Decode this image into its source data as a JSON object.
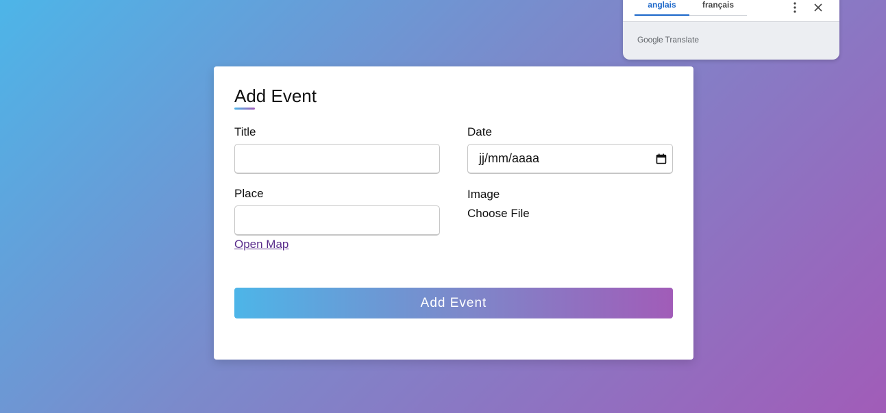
{
  "translate_popup": {
    "tabs": [
      {
        "label": "anglais",
        "active": true
      },
      {
        "label": "français",
        "active": false
      }
    ],
    "brand_google": "Google",
    "brand_translate": "Translate",
    "menu_icon": "more-vert-icon",
    "close_icon": "close-icon",
    "active_color": "#1a66c9"
  },
  "form": {
    "title": "Add Event",
    "fields": {
      "title_label": "Title",
      "date_label": "Date",
      "date_value": "jj/mm/aaaa",
      "place_label": "Place",
      "image_label": "Image",
      "choose_file": "Choose File",
      "open_map": "Open Map"
    },
    "submit_label": "Add Event"
  },
  "colors": {
    "gradient_start": "#4db5e8",
    "gradient_end": "#a15cb8",
    "link": "#5a2d8c"
  }
}
